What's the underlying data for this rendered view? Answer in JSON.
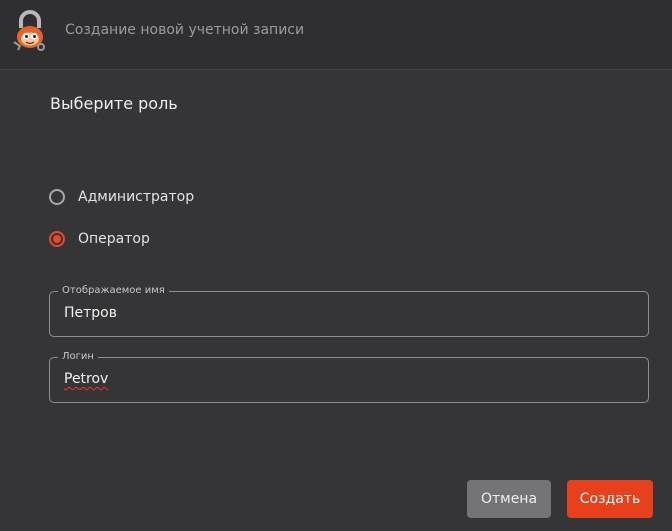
{
  "window": {
    "title": "Создание новой учетной записи",
    "logo_icon": "padlock-mascot-icon"
  },
  "role_section": {
    "title": "Выберите роль",
    "options": [
      {
        "label": "Администратор",
        "selected": false
      },
      {
        "label": "Оператор",
        "selected": true
      }
    ]
  },
  "fields": {
    "display_name": {
      "label": "Отображаемое имя",
      "value": "Петров"
    },
    "login": {
      "label": "Логин",
      "value": "Petrov"
    }
  },
  "buttons": {
    "cancel_label": "Отмена",
    "create_label": "Создать"
  },
  "colors": {
    "accent": "#e8401c",
    "background": "#353537",
    "header": "#2f2f31"
  }
}
